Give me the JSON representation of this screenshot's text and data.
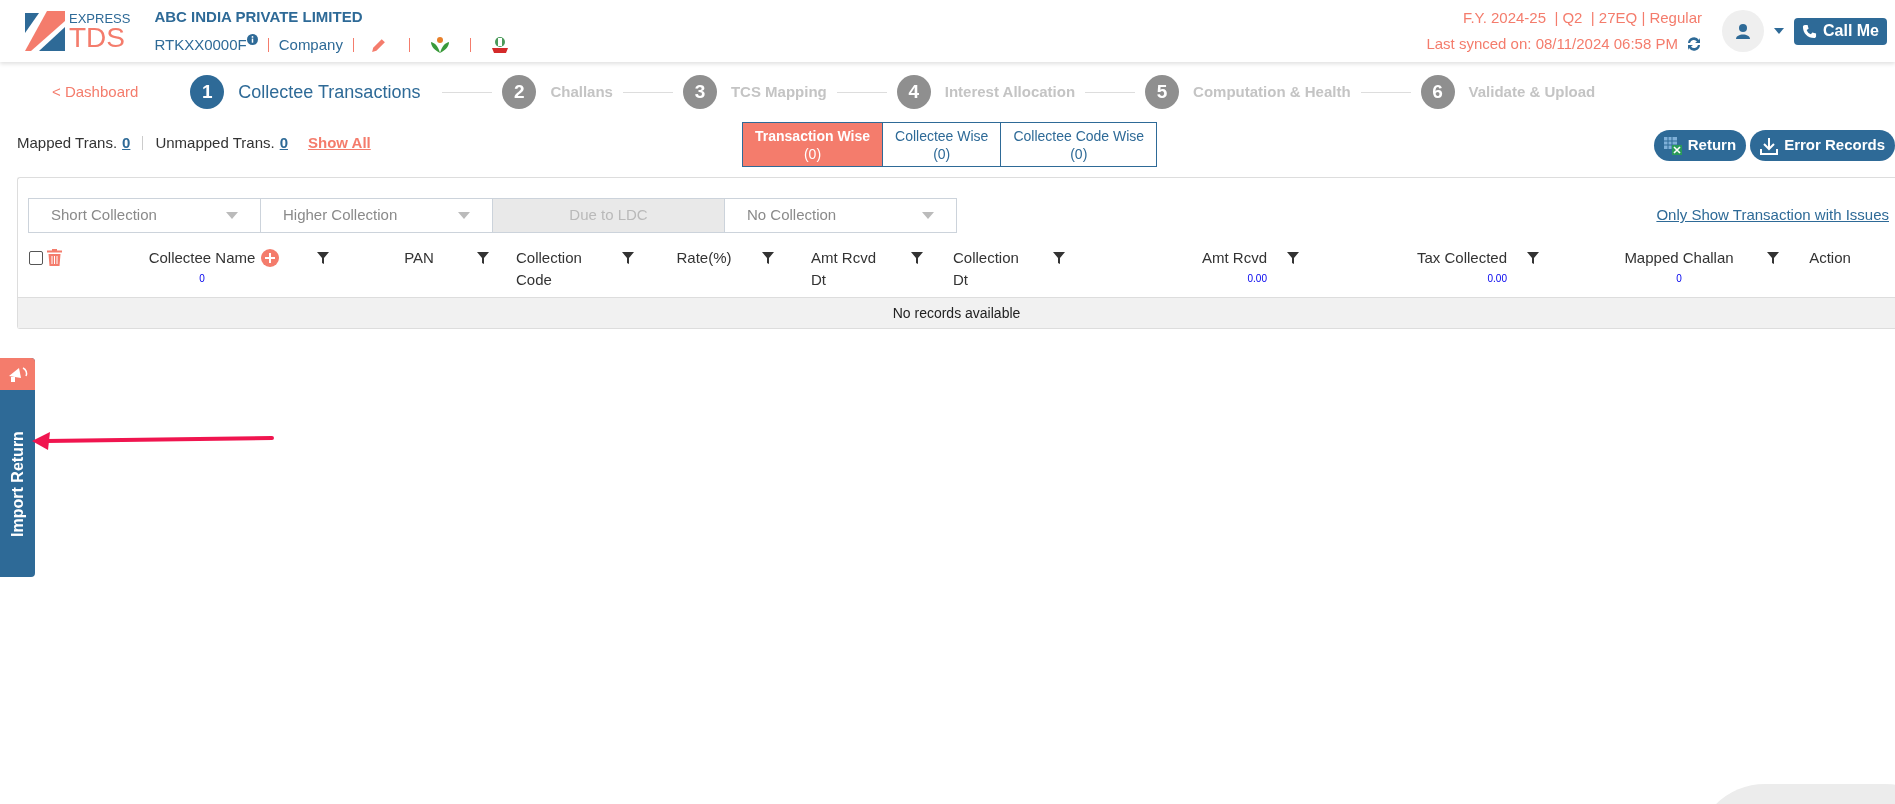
{
  "header": {
    "logo": {
      "top": "EXPRESS",
      "bottom": "TDS"
    },
    "company": "ABC INDIA PRIVATE LIMITED",
    "tan": "RTKXX0000F",
    "entity": "Company",
    "return_info": "F.Y. 2024-25  | Q2  | 27EQ | Regular",
    "last_synced": "Last synced on: 08/11/2024 06:58 PM",
    "call_button": "Call Me"
  },
  "back_link": "< Dashboard",
  "steps": [
    {
      "number": "1",
      "label": "Collectee Transactions",
      "selected": true
    },
    {
      "number": "2",
      "label": "Challans",
      "selected": false
    },
    {
      "number": "3",
      "label": "TCS Mapping",
      "selected": false
    },
    {
      "number": "4",
      "label": "Interest Allocation",
      "selected": false
    },
    {
      "number": "5",
      "label": "Computation & Health",
      "selected": false
    },
    {
      "number": "6",
      "label": "Validate & Upload",
      "selected": false
    }
  ],
  "counts": {
    "mapped_label": "Mapped Trans.",
    "mapped": "0",
    "unmapped_label": "Unmapped Trans.",
    "unmapped": "0",
    "show_all": "Show All"
  },
  "view_tabs": [
    {
      "label": "Transaction Wise",
      "count": "(0)",
      "selected": true
    },
    {
      "label": "Collectee Wise",
      "count": "(0)",
      "selected": false
    },
    {
      "label": "Collectee Code Wise",
      "count": "(0)",
      "selected": false
    }
  ],
  "actions": [
    "Return",
    "Error Records"
  ],
  "filters": [
    {
      "label": "Short Collection",
      "disabled": false
    },
    {
      "label": "Higher Collection",
      "disabled": false
    },
    {
      "label": "Due to LDC",
      "disabled": true
    },
    {
      "label": "No Collection",
      "disabled": false
    }
  ],
  "issues_link": "Only Show Transaction with Issues",
  "table": {
    "select_all_checked": false,
    "columns": [
      {
        "label": "Collectee Name",
        "total": "0",
        "filter": true
      },
      {
        "label": "PAN",
        "filter": true
      },
      {
        "label": "Collection Code",
        "filter": true
      },
      {
        "label": "Rate(%)",
        "filter": true
      },
      {
        "label": "Amt Rcvd Dt",
        "filter": true
      },
      {
        "label": "Collection Dt",
        "filter": true
      },
      {
        "label": "Amt Rcvd",
        "total": "0.00",
        "filter": true
      },
      {
        "label": "Tax Collected",
        "total": "0.00",
        "filter": true
      },
      {
        "label": "Mapped Challan",
        "total": "0",
        "filter": true
      },
      {
        "label": "Action",
        "filter": false
      }
    ],
    "empty_message": "No records available"
  },
  "side_tab": "Import Return"
}
